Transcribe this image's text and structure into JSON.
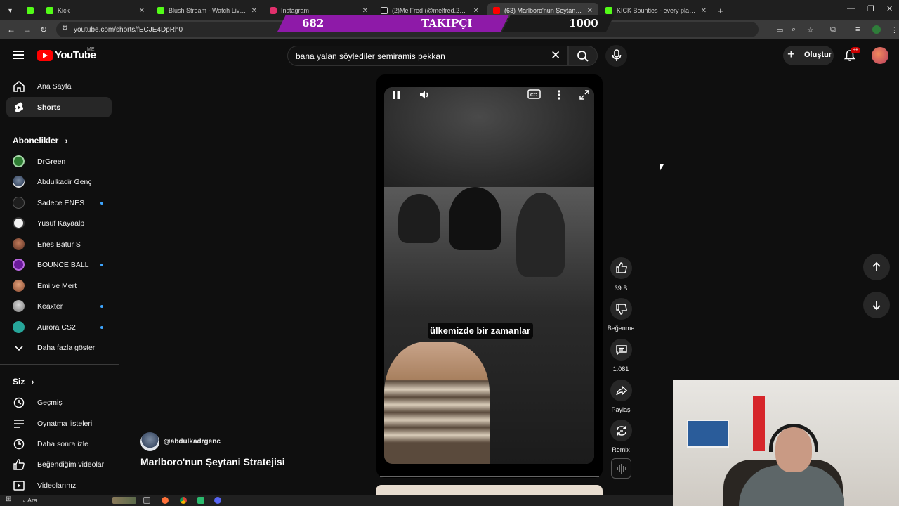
{
  "browser": {
    "tabs": [
      {
        "label": "Kick",
        "fav_color": "#53fc18"
      },
      {
        "label": "Kick",
        "fav_color": "#53fc18"
      },
      {
        "label": "Blush Stream - Watch Live on K",
        "fav_color": "#53fc18"
      },
      {
        "label": "Instagram",
        "fav_color": "#e1306c"
      },
      {
        "label": "(2)MelFred (@melfred.22) | TikT",
        "fav_color": "#111111"
      },
      {
        "label": "(63) Marlboro'nun Şeytani S",
        "fav_color": "#ff0000"
      },
      {
        "label": "KICK Bounties - every player fo",
        "fav_color": "#53fc18"
      }
    ],
    "url": "youtube.com/shorts/fECJE4DpRh0"
  },
  "overlay": {
    "count": "682",
    "label": "TAKIPÇI",
    "goal": "1000"
  },
  "header": {
    "logo_text": "YouTube",
    "country": "ME",
    "search_value": "bana yalan söylediler semiramis pekkan",
    "create_label": "Oluştur",
    "notif_badge": "9+"
  },
  "sidebar": {
    "main": [
      {
        "label": "Ana Sayfa"
      },
      {
        "label": "Shorts"
      }
    ],
    "subs_title": "Abonelikler",
    "subs": [
      {
        "label": "DrGreen",
        "color": "#2e7d32",
        "dot": false
      },
      {
        "label": "Abdulkadir Genç",
        "color": "#5a6b85",
        "dot": false
      },
      {
        "label": "Sadece ENES",
        "color": "#222222",
        "dot": true
      },
      {
        "label": "Yusuf Kayaalp",
        "color": "#e8e8e8",
        "dot": false
      },
      {
        "label": "Enes Batur S",
        "color": "#8a4b3a",
        "dot": false
      },
      {
        "label": "BOUNCE BALL",
        "color": "#6a1b9a",
        "dot": true
      },
      {
        "label": "Emi ve Mert",
        "color": "#c0704a",
        "dot": false
      },
      {
        "label": "Keaxter",
        "color": "#a0a0a0",
        "dot": true
      },
      {
        "label": "Aurora CS2",
        "color": "#26a69a",
        "dot": true
      }
    ],
    "more_label": "Daha fazla göster",
    "you_title": "Siz",
    "you": [
      {
        "label": "Geçmiş"
      },
      {
        "label": "Oynatma listeleri"
      },
      {
        "label": "Daha sonra izle"
      },
      {
        "label": "Beğendiğim videolar"
      },
      {
        "label": "Videolarınız"
      }
    ]
  },
  "video": {
    "caption": "ülkemizde bir zamanlar",
    "channel": "@abdulkadrgenc",
    "title": "Marlboro'nun Şeytani Stratejisi"
  },
  "actions": {
    "likes": "39 B",
    "dislike_label": "Beğenme",
    "comments": "1.081",
    "share_label": "Paylaş",
    "remix_label": "Remix"
  },
  "taskbar": {
    "search_label": "Ara"
  }
}
